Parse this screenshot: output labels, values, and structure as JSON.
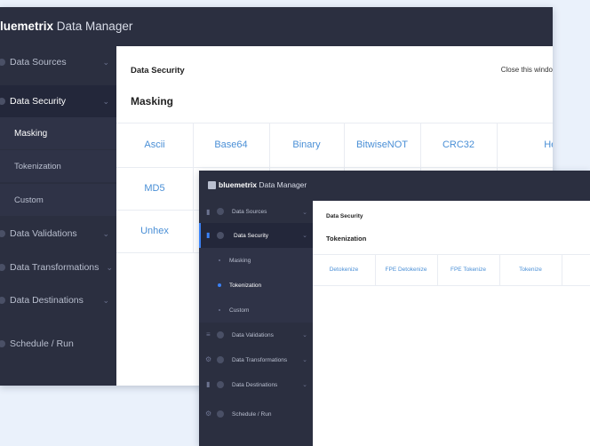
{
  "back": {
    "app_title_bold": "luemetrix",
    "app_title_rest": " Data Manager",
    "sidebar": [
      {
        "label": "Data Sources"
      },
      {
        "label": "Data Security"
      },
      {
        "label": "Masking"
      },
      {
        "label": "Tokenization"
      },
      {
        "label": "Custom"
      },
      {
        "label": "Data Validations"
      },
      {
        "label": "Data Transformations"
      },
      {
        "label": "Data Destinations"
      },
      {
        "label": "Schedule / Run"
      }
    ],
    "breadcrumb": "Data Security",
    "close_text": "Close this windo",
    "section_title": "Masking",
    "cells": [
      "Ascii",
      "Base64",
      "Binary",
      "BitwiseNOT",
      "CRC32",
      "Hex",
      "MD5",
      "Unhex"
    ]
  },
  "front": {
    "app_title_bold": "bluemetrix",
    "app_title_rest": " Data Manager",
    "sidebar": [
      {
        "label": "Data Sources"
      },
      {
        "label": "Data Security"
      },
      {
        "label": "Masking"
      },
      {
        "label": "Tokenization"
      },
      {
        "label": "Custom"
      },
      {
        "label": "Data Validations"
      },
      {
        "label": "Data Transformations"
      },
      {
        "label": "Data Destinations"
      },
      {
        "label": "Schedule / Run"
      }
    ],
    "breadcrumb": "Data Security",
    "section_title": "Tokenization",
    "cells": [
      "Detokenize",
      "FPE Detokenize",
      "FPE Tokenize",
      "Tokenize"
    ]
  },
  "colors": {
    "sidebar": "#2b2f40",
    "sidebar_selected": "#23273a",
    "accent": "#4a8fd6",
    "indicator": "#3b82f6"
  }
}
